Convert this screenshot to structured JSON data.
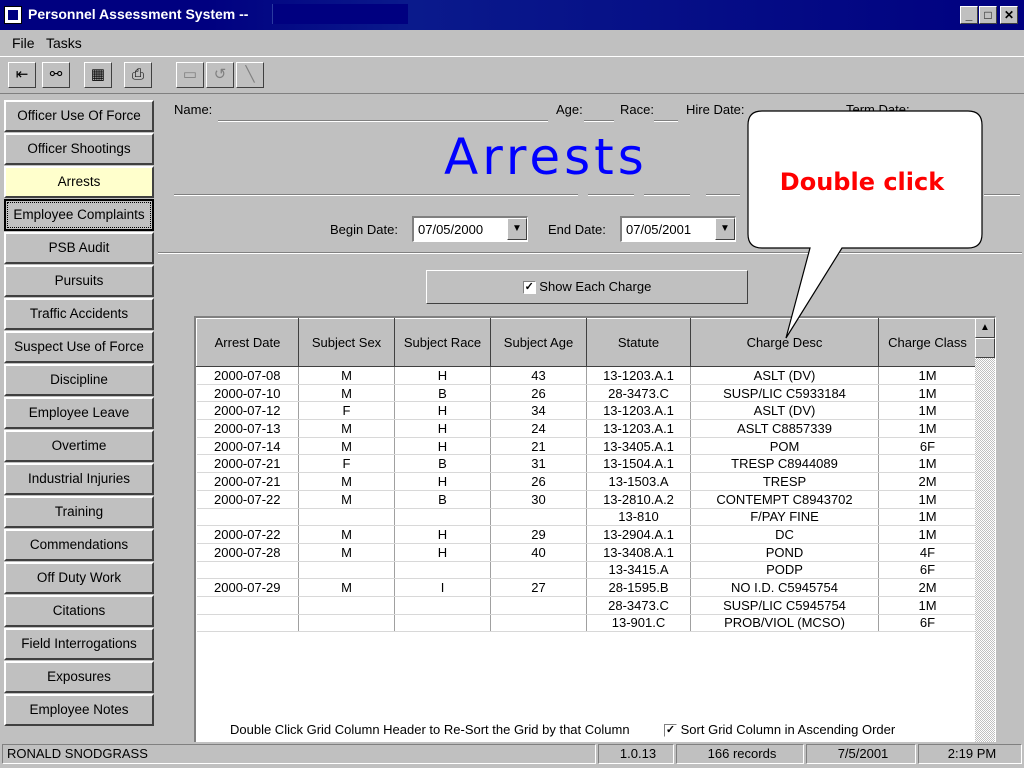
{
  "window": {
    "title": "Personnel Assessment System --"
  },
  "menu": {
    "file": "File",
    "tasks": "Tasks"
  },
  "toolbar": [
    {
      "name": "exit-icon",
      "glyph": "⇤"
    },
    {
      "name": "binoculars-icon",
      "glyph": "⚯"
    },
    {
      "name": "report-icon",
      "glyph": "▦"
    },
    {
      "name": "print-icon",
      "glyph": "⎙"
    },
    {
      "name": "save-icon",
      "glyph": "▭"
    },
    {
      "name": "undo-icon",
      "glyph": "↺"
    },
    {
      "name": "edit-icon",
      "glyph": "╲"
    }
  ],
  "sidebar": {
    "items": [
      "Officer Use Of Force",
      "Officer Shootings",
      "Arrests",
      "Employee Complaints",
      "PSB Audit",
      "Pursuits",
      "Traffic Accidents",
      "Suspect Use of Force",
      "Discipline",
      "Employee Leave",
      "Overtime",
      "Industrial Injuries",
      "Training",
      "Commendations",
      "Off Duty Work",
      "Citations",
      "Field Interrogations",
      "Exposures",
      "Employee Notes"
    ],
    "active_index": 2,
    "focused_index": 3
  },
  "header": {
    "name_label": "Name:",
    "age_label": "Age:",
    "race_label": "Race:",
    "hire_label": "Hire Date:",
    "term_label": "Term Date:",
    "big_title": "Arrests"
  },
  "filters": {
    "begin_label": "Begin Date:",
    "begin_value": "07/05/2000",
    "end_label": "End Date:",
    "end_value": "07/05/2001",
    "show_each_label": "Show Each Charge",
    "show_each_checked": true
  },
  "callout": {
    "text": "Double click"
  },
  "grid": {
    "columns": [
      "Arrest Date",
      "Subject Sex",
      "Subject Race",
      "Subject Age",
      "Statute",
      "Charge Desc",
      "Charge Class"
    ],
    "rows": [
      [
        "2000-07-08",
        "M",
        "H",
        "43",
        "13-1203.A.1",
        "ASLT (DV)",
        "1M"
      ],
      [
        "2000-07-10",
        "M",
        "B",
        "26",
        "28-3473.C",
        "SUSP/LIC  C5933184",
        "1M"
      ],
      [
        "2000-07-12",
        "F",
        "H",
        "34",
        "13-1203.A.1",
        "ASLT   (DV)",
        "1M"
      ],
      [
        "2000-07-13",
        "M",
        "H",
        "24",
        "13-1203.A.1",
        "ASLT     C8857339",
        "1M"
      ],
      [
        "2000-07-14",
        "M",
        "H",
        "21",
        "13-3405.A.1",
        "POM",
        "6F"
      ],
      [
        "2000-07-21",
        "F",
        "B",
        "31",
        "13-1504.A.1",
        "TRESP     C8944089",
        "1M"
      ],
      [
        "2000-07-21",
        "M",
        "H",
        "26",
        "13-1503.A",
        "TRESP",
        "2M"
      ],
      [
        "2000-07-22",
        "M",
        "B",
        "30",
        "13-2810.A.2",
        "CONTEMPT C8943702",
        "1M"
      ],
      [
        "",
        "",
        "",
        "",
        "13-810",
        "F/PAY FINE",
        "1M"
      ],
      [
        "2000-07-22",
        "M",
        "H",
        "29",
        "13-2904.A.1",
        "DC",
        "1M"
      ],
      [
        "2000-07-28",
        "M",
        "H",
        "40",
        "13-3408.A.1",
        "POND",
        "4F"
      ],
      [
        "",
        "",
        "",
        "",
        "13-3415.A",
        "PODP",
        "6F"
      ],
      [
        "2000-07-29",
        "M",
        "I",
        "27",
        "28-1595.B",
        "NO I.D.  C5945754",
        "2M"
      ],
      [
        "",
        "",
        "",
        "",
        "28-3473.C",
        "SUSP/LIC  C5945754",
        "1M"
      ],
      [
        "",
        "",
        "",
        "",
        "13-901.C",
        "PROB/VIOL  (MCSO)",
        "6F"
      ]
    ]
  },
  "footer": {
    "hint": "Double Click Grid Column Header to Re-Sort the Grid by that Column",
    "sort_label": "Sort Grid Column in Ascending Order",
    "sort_checked": true
  },
  "status": {
    "user": "RONALD SNODGRASS",
    "version": "1.0.13",
    "records": "166 records",
    "date": "7/5/2001",
    "time": "2:19 PM"
  },
  "colors": {
    "title_blue": "#0000ff",
    "callout_red": "#ff0000",
    "active_nav": "#ffffcc",
    "titlebar": "#000080"
  }
}
